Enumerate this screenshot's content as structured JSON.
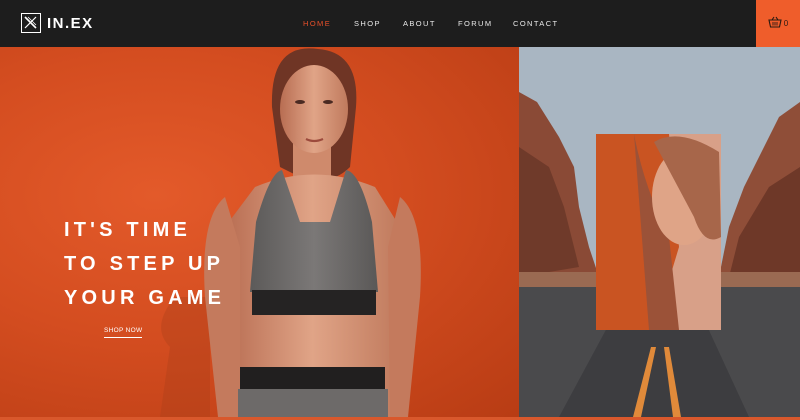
{
  "brand": {
    "name": "IN.EX"
  },
  "nav": {
    "items": [
      {
        "label": "HOME",
        "active": true
      },
      {
        "label": "SHOP",
        "active": false
      },
      {
        "label": "ABOUT",
        "active": false
      },
      {
        "label": "FORUM",
        "active": false
      },
      {
        "label": "CONTACT",
        "active": false
      }
    ],
    "cart_count": "0"
  },
  "hero": {
    "headline_lines": [
      "IT'S TIME",
      "TO STEP UP",
      "YOUR GAME"
    ],
    "cta_label": "SHOP NOW"
  },
  "icons": {
    "logo": "x-monogram-icon",
    "cart": "shopping-basket-icon"
  },
  "colors": {
    "accent": "#e8502a",
    "hero_bg": "#d44d20",
    "nav_bg": "#1d1d1d"
  }
}
